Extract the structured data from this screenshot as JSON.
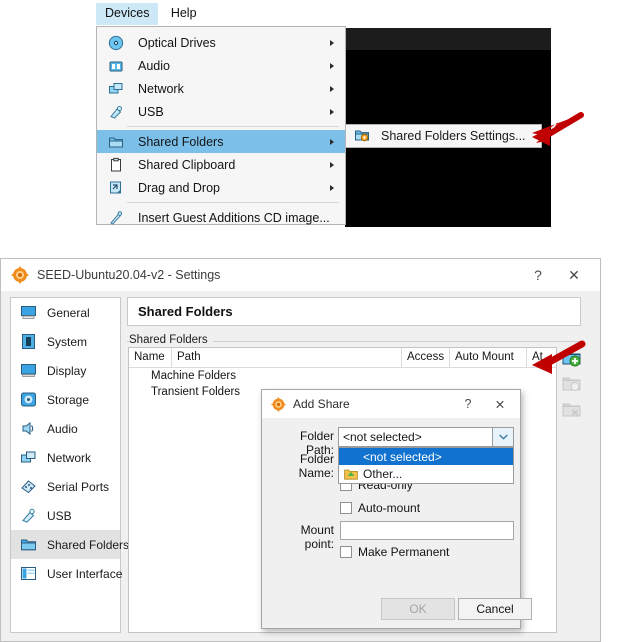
{
  "vm_menu": {
    "menubar": [
      {
        "label": "Devices",
        "active": true
      },
      {
        "label": "Help",
        "active": false
      }
    ],
    "items": [
      {
        "label": "Optical Drives",
        "icon": "optical-drive-icon",
        "submenu": true,
        "selected": false
      },
      {
        "label": "Audio",
        "icon": "audio-icon",
        "submenu": true,
        "selected": false
      },
      {
        "label": "Network",
        "icon": "network-icon",
        "submenu": true,
        "selected": false
      },
      {
        "label": "USB",
        "icon": "usb-icon",
        "submenu": true,
        "selected": false
      },
      {
        "label": "Shared Folders",
        "icon": "shared-folders-icon",
        "submenu": true,
        "selected": true
      },
      {
        "label": "Shared Clipboard",
        "icon": "clipboard-icon",
        "submenu": true,
        "selected": false
      },
      {
        "label": "Drag and Drop",
        "icon": "drag-drop-icon",
        "submenu": true,
        "selected": false
      },
      {
        "label": "Insert Guest Additions CD image...",
        "icon": "guest-additions-icon",
        "submenu": false,
        "selected": false
      }
    ],
    "submenu_item": {
      "label": "Shared Folders Settings...",
      "icon": "shared-folders-settings-icon"
    }
  },
  "settings": {
    "title": "SEED-Ubuntu20.04-v2 - Settings",
    "title_icon": "virtualbox-icon",
    "help_button": "?",
    "close_button": "✕",
    "sidebar": [
      {
        "label": "General",
        "icon": "general-icon",
        "active": false
      },
      {
        "label": "System",
        "icon": "system-icon",
        "active": false
      },
      {
        "label": "Display",
        "icon": "display-icon",
        "active": false
      },
      {
        "label": "Storage",
        "icon": "storage-icon",
        "active": false
      },
      {
        "label": "Audio",
        "icon": "audio-icon",
        "active": false
      },
      {
        "label": "Network",
        "icon": "network-icon",
        "active": false
      },
      {
        "label": "Serial Ports",
        "icon": "serial-ports-icon",
        "active": false
      },
      {
        "label": "USB",
        "icon": "usb-icon",
        "active": false
      },
      {
        "label": "Shared Folders",
        "icon": "shared-folders-icon",
        "active": true
      },
      {
        "label": "User Interface",
        "icon": "user-interface-icon",
        "active": false
      }
    ],
    "panel_title": "Shared Folders",
    "group_label": "Shared Folders",
    "table": {
      "columns": [
        "Name",
        "Path",
        "Access",
        "Auto Mount",
        "At"
      ],
      "rows": [
        "Machine Folders",
        "Transient Folders"
      ]
    },
    "tools": [
      {
        "name": "add-shared-folder-button",
        "enabled": true
      },
      {
        "name": "edit-shared-folder-button",
        "enabled": false
      },
      {
        "name": "remove-shared-folder-button",
        "enabled": false
      }
    ]
  },
  "add_share": {
    "title": "Add Share",
    "title_icon": "virtualbox-icon",
    "help_button": "?",
    "close_button": "✕",
    "folder_path_label": "Folder Path:",
    "folder_path_value": "<not selected>",
    "folder_name_label": "Folder Name:",
    "dropdown_options": [
      {
        "label": "<not selected>",
        "selected": true,
        "icon": null
      },
      {
        "label": "Other...",
        "selected": false,
        "icon": "folder-other-icon"
      }
    ],
    "checkboxes": [
      {
        "label": "Read-only",
        "checked": false
      },
      {
        "label": "Auto-mount",
        "checked": false
      },
      {
        "label": "Make Permanent",
        "checked": false
      }
    ],
    "mount_point_label": "Mount point:",
    "mount_point_value": "",
    "ok_label": "OK",
    "cancel_label": "Cancel"
  },
  "colors": {
    "menu_highlight": "#7cc0ea",
    "dropdown_highlight": "#1172d0",
    "arrow_red": "#c00000",
    "sidebar_active": "#e2e2e2"
  }
}
